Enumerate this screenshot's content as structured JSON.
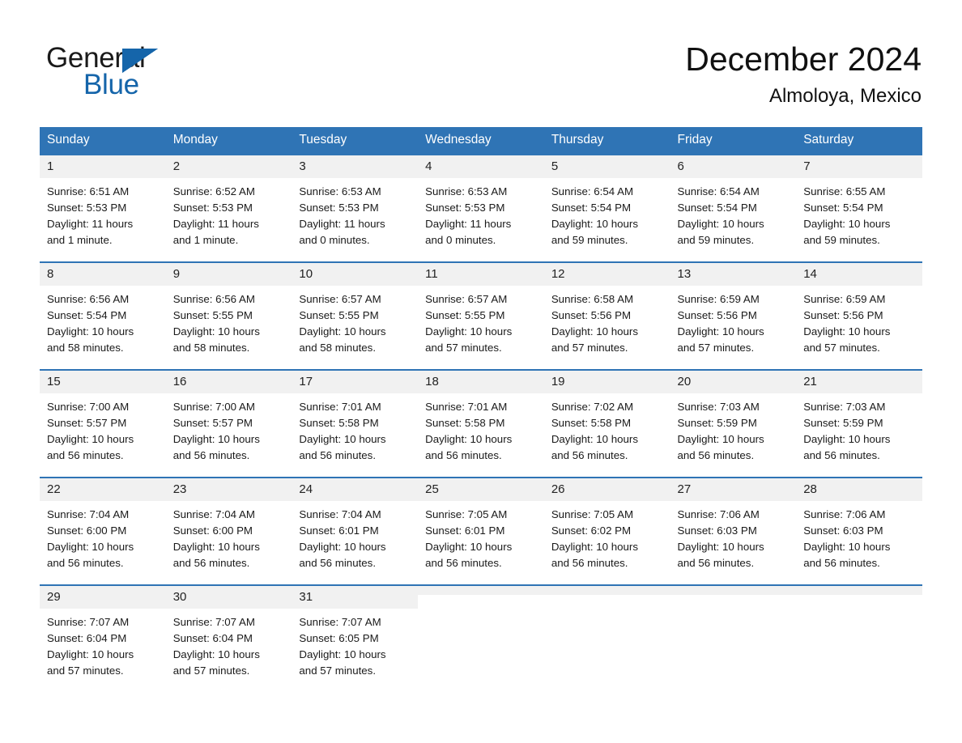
{
  "brand": {
    "name_part1": "General",
    "name_part2": "Blue",
    "accent_color": "#1565aa",
    "logo_icon": "triangle-icon"
  },
  "header": {
    "month_year": "December 2024",
    "location": "Almoloya, Mexico"
  },
  "theme": {
    "header_blue": "#2f74b5",
    "daynum_band": "#f1f1f1",
    "text": "#1a1a1a"
  },
  "weekday_headers": [
    "Sunday",
    "Monday",
    "Tuesday",
    "Wednesday",
    "Thursday",
    "Friday",
    "Saturday"
  ],
  "weeks": [
    [
      {
        "day": "1",
        "sunrise": "Sunrise: 6:51 AM",
        "sunset": "Sunset: 5:53 PM",
        "daylight_line1": "Daylight: 11 hours",
        "daylight_line2": "and 1 minute."
      },
      {
        "day": "2",
        "sunrise": "Sunrise: 6:52 AM",
        "sunset": "Sunset: 5:53 PM",
        "daylight_line1": "Daylight: 11 hours",
        "daylight_line2": "and 1 minute."
      },
      {
        "day": "3",
        "sunrise": "Sunrise: 6:53 AM",
        "sunset": "Sunset: 5:53 PM",
        "daylight_line1": "Daylight: 11 hours",
        "daylight_line2": "and 0 minutes."
      },
      {
        "day": "4",
        "sunrise": "Sunrise: 6:53 AM",
        "sunset": "Sunset: 5:53 PM",
        "daylight_line1": "Daylight: 11 hours",
        "daylight_line2": "and 0 minutes."
      },
      {
        "day": "5",
        "sunrise": "Sunrise: 6:54 AM",
        "sunset": "Sunset: 5:54 PM",
        "daylight_line1": "Daylight: 10 hours",
        "daylight_line2": "and 59 minutes."
      },
      {
        "day": "6",
        "sunrise": "Sunrise: 6:54 AM",
        "sunset": "Sunset: 5:54 PM",
        "daylight_line1": "Daylight: 10 hours",
        "daylight_line2": "and 59 minutes."
      },
      {
        "day": "7",
        "sunrise": "Sunrise: 6:55 AM",
        "sunset": "Sunset: 5:54 PM",
        "daylight_line1": "Daylight: 10 hours",
        "daylight_line2": "and 59 minutes."
      }
    ],
    [
      {
        "day": "8",
        "sunrise": "Sunrise: 6:56 AM",
        "sunset": "Sunset: 5:54 PM",
        "daylight_line1": "Daylight: 10 hours",
        "daylight_line2": "and 58 minutes."
      },
      {
        "day": "9",
        "sunrise": "Sunrise: 6:56 AM",
        "sunset": "Sunset: 5:55 PM",
        "daylight_line1": "Daylight: 10 hours",
        "daylight_line2": "and 58 minutes."
      },
      {
        "day": "10",
        "sunrise": "Sunrise: 6:57 AM",
        "sunset": "Sunset: 5:55 PM",
        "daylight_line1": "Daylight: 10 hours",
        "daylight_line2": "and 58 minutes."
      },
      {
        "day": "11",
        "sunrise": "Sunrise: 6:57 AM",
        "sunset": "Sunset: 5:55 PM",
        "daylight_line1": "Daylight: 10 hours",
        "daylight_line2": "and 57 minutes."
      },
      {
        "day": "12",
        "sunrise": "Sunrise: 6:58 AM",
        "sunset": "Sunset: 5:56 PM",
        "daylight_line1": "Daylight: 10 hours",
        "daylight_line2": "and 57 minutes."
      },
      {
        "day": "13",
        "sunrise": "Sunrise: 6:59 AM",
        "sunset": "Sunset: 5:56 PM",
        "daylight_line1": "Daylight: 10 hours",
        "daylight_line2": "and 57 minutes."
      },
      {
        "day": "14",
        "sunrise": "Sunrise: 6:59 AM",
        "sunset": "Sunset: 5:56 PM",
        "daylight_line1": "Daylight: 10 hours",
        "daylight_line2": "and 57 minutes."
      }
    ],
    [
      {
        "day": "15",
        "sunrise": "Sunrise: 7:00 AM",
        "sunset": "Sunset: 5:57 PM",
        "daylight_line1": "Daylight: 10 hours",
        "daylight_line2": "and 56 minutes."
      },
      {
        "day": "16",
        "sunrise": "Sunrise: 7:00 AM",
        "sunset": "Sunset: 5:57 PM",
        "daylight_line1": "Daylight: 10 hours",
        "daylight_line2": "and 56 minutes."
      },
      {
        "day": "17",
        "sunrise": "Sunrise: 7:01 AM",
        "sunset": "Sunset: 5:58 PM",
        "daylight_line1": "Daylight: 10 hours",
        "daylight_line2": "and 56 minutes."
      },
      {
        "day": "18",
        "sunrise": "Sunrise: 7:01 AM",
        "sunset": "Sunset: 5:58 PM",
        "daylight_line1": "Daylight: 10 hours",
        "daylight_line2": "and 56 minutes."
      },
      {
        "day": "19",
        "sunrise": "Sunrise: 7:02 AM",
        "sunset": "Sunset: 5:58 PM",
        "daylight_line1": "Daylight: 10 hours",
        "daylight_line2": "and 56 minutes."
      },
      {
        "day": "20",
        "sunrise": "Sunrise: 7:03 AM",
        "sunset": "Sunset: 5:59 PM",
        "daylight_line1": "Daylight: 10 hours",
        "daylight_line2": "and 56 minutes."
      },
      {
        "day": "21",
        "sunrise": "Sunrise: 7:03 AM",
        "sunset": "Sunset: 5:59 PM",
        "daylight_line1": "Daylight: 10 hours",
        "daylight_line2": "and 56 minutes."
      }
    ],
    [
      {
        "day": "22",
        "sunrise": "Sunrise: 7:04 AM",
        "sunset": "Sunset: 6:00 PM",
        "daylight_line1": "Daylight: 10 hours",
        "daylight_line2": "and 56 minutes."
      },
      {
        "day": "23",
        "sunrise": "Sunrise: 7:04 AM",
        "sunset": "Sunset: 6:00 PM",
        "daylight_line1": "Daylight: 10 hours",
        "daylight_line2": "and 56 minutes."
      },
      {
        "day": "24",
        "sunrise": "Sunrise: 7:04 AM",
        "sunset": "Sunset: 6:01 PM",
        "daylight_line1": "Daylight: 10 hours",
        "daylight_line2": "and 56 minutes."
      },
      {
        "day": "25",
        "sunrise": "Sunrise: 7:05 AM",
        "sunset": "Sunset: 6:01 PM",
        "daylight_line1": "Daylight: 10 hours",
        "daylight_line2": "and 56 minutes."
      },
      {
        "day": "26",
        "sunrise": "Sunrise: 7:05 AM",
        "sunset": "Sunset: 6:02 PM",
        "daylight_line1": "Daylight: 10 hours",
        "daylight_line2": "and 56 minutes."
      },
      {
        "day": "27",
        "sunrise": "Sunrise: 7:06 AM",
        "sunset": "Sunset: 6:03 PM",
        "daylight_line1": "Daylight: 10 hours",
        "daylight_line2": "and 56 minutes."
      },
      {
        "day": "28",
        "sunrise": "Sunrise: 7:06 AM",
        "sunset": "Sunset: 6:03 PM",
        "daylight_line1": "Daylight: 10 hours",
        "daylight_line2": "and 56 minutes."
      }
    ],
    [
      {
        "day": "29",
        "sunrise": "Sunrise: 7:07 AM",
        "sunset": "Sunset: 6:04 PM",
        "daylight_line1": "Daylight: 10 hours",
        "daylight_line2": "and 57 minutes."
      },
      {
        "day": "30",
        "sunrise": "Sunrise: 7:07 AM",
        "sunset": "Sunset: 6:04 PM",
        "daylight_line1": "Daylight: 10 hours",
        "daylight_line2": "and 57 minutes."
      },
      {
        "day": "31",
        "sunrise": "Sunrise: 7:07 AM",
        "sunset": "Sunset: 6:05 PM",
        "daylight_line1": "Daylight: 10 hours",
        "daylight_line2": "and 57 minutes."
      },
      {
        "day": "",
        "sunrise": "",
        "sunset": "",
        "daylight_line1": "",
        "daylight_line2": ""
      },
      {
        "day": "",
        "sunrise": "",
        "sunset": "",
        "daylight_line1": "",
        "daylight_line2": ""
      },
      {
        "day": "",
        "sunrise": "",
        "sunset": "",
        "daylight_line1": "",
        "daylight_line2": ""
      },
      {
        "day": "",
        "sunrise": "",
        "sunset": "",
        "daylight_line1": "",
        "daylight_line2": ""
      }
    ]
  ]
}
